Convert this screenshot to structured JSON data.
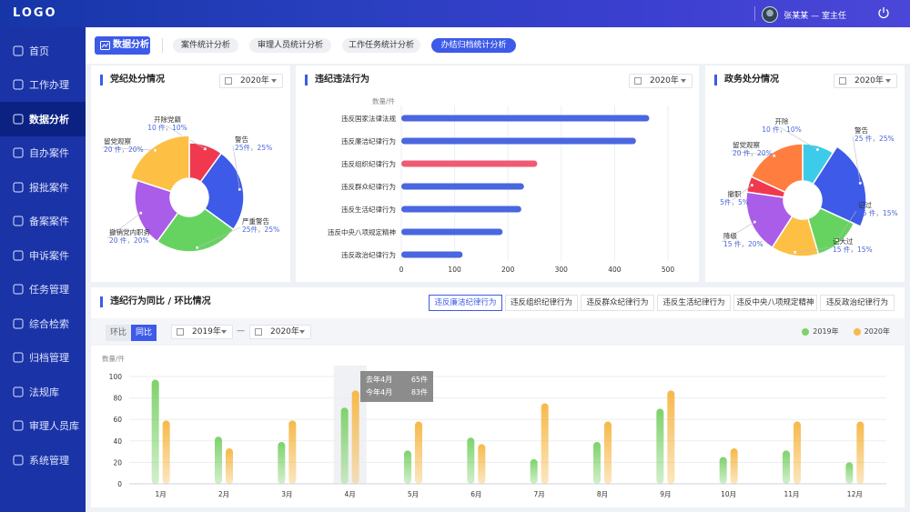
{
  "header": {
    "logo": "LOGO",
    "user": "张某某 — 室主任"
  },
  "sidebar": {
    "items": [
      {
        "label": "首页",
        "icon": "home-icon"
      },
      {
        "label": "工作办理",
        "icon": "briefcase-icon"
      },
      {
        "label": "数据分析",
        "icon": "analytics-icon",
        "active": true
      },
      {
        "label": "自办案件",
        "icon": "clipboard-icon"
      },
      {
        "label": "报批案件",
        "icon": "document-edit-icon"
      },
      {
        "label": "备案案件",
        "icon": "id-card-icon"
      },
      {
        "label": "申诉案件",
        "icon": "appeal-icon"
      },
      {
        "label": "任务管理",
        "icon": "task-icon"
      },
      {
        "label": "综合检索",
        "icon": "grid-icon"
      },
      {
        "label": "归档管理",
        "icon": "archive-icon"
      },
      {
        "label": "法规库",
        "icon": "scale-icon"
      },
      {
        "label": "审理人员库",
        "icon": "people-icon"
      },
      {
        "label": "系统管理",
        "icon": "gear-icon"
      }
    ]
  },
  "tabs": {
    "main": "数据分析",
    "items": [
      "案件统计分析",
      "审理人员统计分析",
      "工作任务统计分析",
      "办结归档统计分析"
    ],
    "active": 3
  },
  "party_panel": {
    "title": "党纪处分情况",
    "year": "2020年",
    "slices": [
      {
        "name": "开除党籍",
        "count": "10 件",
        "pct": "10%",
        "value": 10,
        "color": "#f0394f"
      },
      {
        "name": "警告",
        "count": "25件",
        "pct": "25%",
        "value": 25,
        "color": "#3d5ae8"
      },
      {
        "name": "严重警告",
        "count": "25件",
        "pct": "25%",
        "value": 25,
        "color": "#66d361"
      },
      {
        "name": "撤销党内职务",
        "count": "20 件",
        "pct": "20%",
        "value": 20,
        "color": "#a95de8"
      },
      {
        "name": "留党观察",
        "count": "20 件",
        "pct": "20%",
        "value": 20,
        "color": "#fdc044"
      }
    ]
  },
  "violation_panel": {
    "title": "违纪违法行为",
    "year": "2020年",
    "unit": "数量/件",
    "chart_data": {
      "type": "bar",
      "orientation": "horizontal",
      "categories": [
        "违反国家法律法规",
        "违反廉洁纪律行为",
        "违反组织纪律行为",
        "违反群众纪律行为",
        "违反生活纪律行为",
        "违反中央八项规定精神",
        "违反政治纪律行为"
      ],
      "values": [
        465,
        440,
        255,
        230,
        225,
        190,
        115
      ],
      "colors": [
        "#4a66e0",
        "#4a66e0",
        "#f05a74",
        "#4a66e0",
        "#4a66e0",
        "#4a66e0",
        "#4a66e0"
      ],
      "xlim": [
        0,
        500
      ],
      "xticks": [
        0,
        100,
        200,
        300,
        400,
        500
      ]
    }
  },
  "gov_panel": {
    "title": "政务处分情况",
    "year": "2020年",
    "slices": [
      {
        "name": "开除",
        "count": "10 件",
        "pct": "10%",
        "value": 10,
        "color": "#3ccbe8"
      },
      {
        "name": "警告",
        "count": "25 件",
        "pct": "25%",
        "value": 25,
        "color": "#3d5ae8"
      },
      {
        "name": "记过",
        "count": "25 件",
        "pct": "15%",
        "value": 15,
        "color": "#66d361"
      },
      {
        "name": "记大过",
        "count": "15 件",
        "pct": "15%",
        "value": 15,
        "color": "#fdc044"
      },
      {
        "name": "降级",
        "count": "15 件",
        "pct": "20%",
        "value": 20,
        "color": "#a95de8"
      },
      {
        "name": "撤职",
        "count": "5件",
        "pct": "5%",
        "value": 5,
        "color": "#f0394f"
      },
      {
        "name": "留党观察",
        "count": "20 件",
        "pct": "20%",
        "value": 20,
        "color": "#ff7e3f"
      }
    ]
  },
  "trend_panel": {
    "title": "违纪行为同比 / 环比情况",
    "filters": [
      "违反廉洁纪律行为",
      "违反组织纪律行为",
      "违反群众纪律行为",
      "违反生活纪律行为",
      "违反中央八项规定精神",
      "违反政治纪律行为"
    ],
    "active_filter": 0,
    "toggle": {
      "mom": "环比",
      "yoy": "同比"
    },
    "year_from": "2019年",
    "dash": "—",
    "year_to": "2020年",
    "unit": "数量/件",
    "tooltip": {
      "row1_label": "去年4月",
      "row1_value": "65件",
      "row2_label": "今年4月",
      "row2_value": "83件"
    },
    "chart_data": {
      "type": "bar",
      "categories": [
        "1月",
        "2月",
        "3月",
        "4月",
        "5月",
        "6月",
        "7月",
        "8月",
        "9月",
        "10月",
        "11月",
        "12月"
      ],
      "series": [
        {
          "name": "2019年",
          "color": "#7ed26b",
          "values": [
            97,
            44,
            39,
            71,
            31,
            43,
            23,
            39,
            70,
            25,
            31,
            20
          ]
        },
        {
          "name": "2020年",
          "color": "#f6b94a",
          "values": [
            59,
            33,
            59,
            87,
            58,
            37,
            75,
            58,
            87,
            33,
            58,
            58
          ]
        }
      ],
      "ylim": [
        0,
        100
      ],
      "yticks": [
        0,
        20,
        40,
        60,
        80,
        100
      ],
      "highlight_index": 3
    }
  }
}
